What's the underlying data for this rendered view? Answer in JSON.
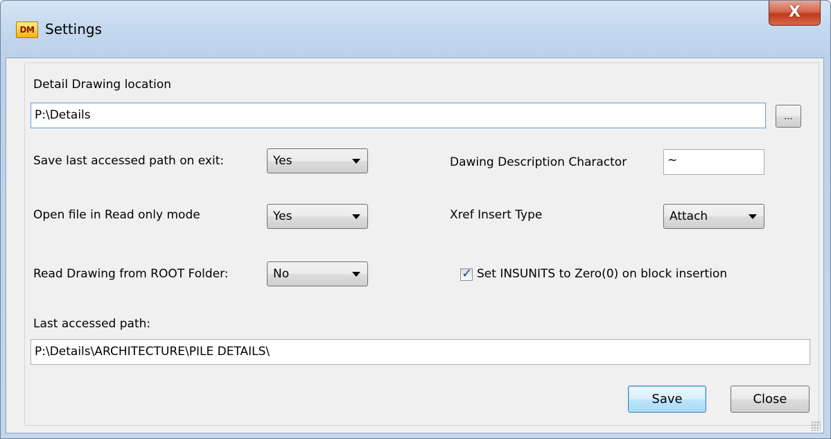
{
  "window": {
    "title": "Settings",
    "icon_text": "DM",
    "close_glyph": "X"
  },
  "detail_location": {
    "label": "Detail Drawing location",
    "value": "P:\\Details",
    "browse_label": "..."
  },
  "save_last_path": {
    "label": "Save last accessed path on exit:",
    "value": "Yes"
  },
  "open_readonly": {
    "label": "Open file in Read only mode",
    "value": "Yes"
  },
  "read_root": {
    "label": "Read Drawing from ROOT Folder:",
    "value": "No"
  },
  "description_char": {
    "label": "Dawing Description Charactor",
    "value": "~"
  },
  "xref_type": {
    "label": "Xref Insert Type",
    "value": "Attach"
  },
  "insunits": {
    "label": "Set INSUNITS to Zero(0) on block insertion",
    "checked": true
  },
  "last_path": {
    "label": "Last accessed path:",
    "value": "P:\\Details\\ARCHITECTURE\\PILE DETAILS\\"
  },
  "buttons": {
    "save": "Save",
    "close": "Close"
  }
}
